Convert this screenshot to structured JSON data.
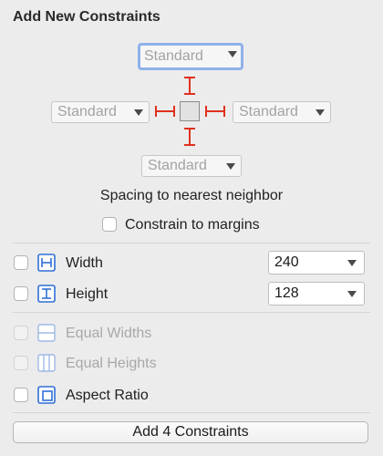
{
  "header": {
    "title": "Add New Constraints"
  },
  "spacing": {
    "top": "Standard",
    "left": "Standard",
    "right": "Standard",
    "bottom": "Standard",
    "caption": "Spacing to nearest neighbor",
    "constrain_margins_label": "Constrain to margins"
  },
  "size": {
    "width_label": "Width",
    "width_value": "240",
    "height_label": "Height",
    "height_value": "128"
  },
  "equal": {
    "equal_widths_label": "Equal Widths",
    "equal_heights_label": "Equal Heights",
    "aspect_ratio_label": "Aspect Ratio"
  },
  "footer": {
    "add_button_label": "Add 4 Constraints"
  },
  "colors": {
    "constraint_red": "#e0301e",
    "icon_blue": "#2f6fd6",
    "focus_ring": "#8fb1ea"
  }
}
